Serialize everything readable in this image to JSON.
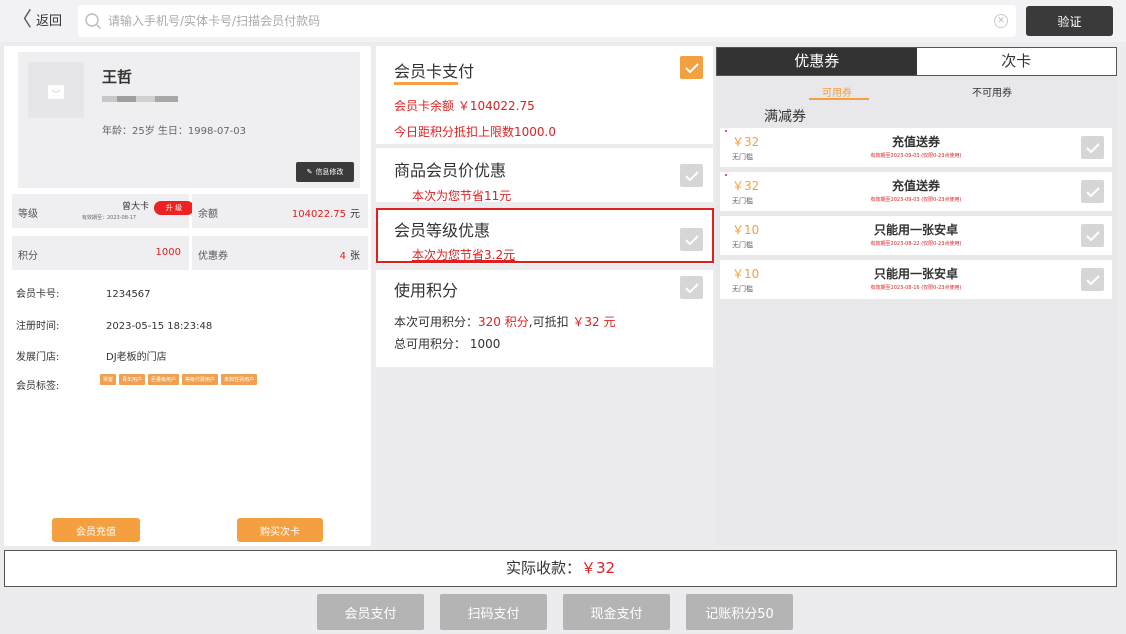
{
  "topbar": {
    "back_label": "返回",
    "search_placeholder": "请输入手机号/实体卡号/扫描会员付款码",
    "verify_label": "验证"
  },
  "member": {
    "name": "王哲",
    "age_birth": "年龄：25岁  生日：1998-07-03",
    "edit_label": "信息修改",
    "level_label": "等级",
    "level_name": "曾大卡",
    "level_expiry": "有效期至：2023-08-17",
    "upgrade_label": "升 级",
    "balance_label": "余额",
    "balance_value": "104022.75",
    "balance_unit": "元",
    "points_label": "积分",
    "points_value": "1000",
    "coupons_label": "优惠券",
    "coupons_value": "4",
    "coupons_unit": "张",
    "card_no_label": "会员卡号:",
    "card_no": "1234567",
    "reg_time_label": "注册时间:",
    "reg_time": "2023-05-15 18:23:48",
    "store_label": "发展门店:",
    "store": "DJ老板的门店",
    "tags_label": "会员标签:",
    "tags": [
      "常客",
      "青年用户",
      "巨量级用户",
      "等级付费用户",
      "未知性别用户"
    ],
    "recharge_label": "会员充值",
    "buy_card_label": "购买次卡"
  },
  "payment": {
    "card_pay_title": "会员卡支付",
    "card_balance": "会员卡余额  ￥104022.75",
    "points_limit": "今日距积分抵扣上限数1000.0",
    "price_discount_title": "商品会员价优惠",
    "price_discount_save": "本次为您节省11元",
    "level_discount_title": "会员等级优惠",
    "level_discount_save": "本次为您节省3.2元",
    "use_points_title": "使用积分",
    "points_usable_prefix": "本次可用积分：",
    "points_usable": "320 积分",
    "points_deduct_prefix": ",可抵扣",
    "points_deduct": "￥32 元",
    "points_total": "总可用积分：  1000",
    "card_pay_checked": true,
    "price_discount_checked": false,
    "level_discount_checked": false,
    "use_points_checked": false
  },
  "coupons": {
    "tab_coupons": "优惠券",
    "tab_cards": "次卡",
    "sub_available": "可用券",
    "sub_unavailable": "不可用券",
    "type_label": "满减券",
    "items": [
      {
        "amount": "￥32",
        "threshold": "无门槛",
        "name": "充值送券",
        "validity": "有效期至2023-09-03 (仅限0-23点使用)"
      },
      {
        "amount": "￥32",
        "threshold": "无门槛",
        "name": "充值送券",
        "validity": "有效期至2023-09-03 (仅限0-23点使用)"
      },
      {
        "amount": "￥10",
        "threshold": "无门槛",
        "name": "只能用一张安卓",
        "validity": "有效期至2023-08-22 (仅限0-23点使用)"
      },
      {
        "amount": "￥10",
        "threshold": "无门槛",
        "name": "只能用一张安卓",
        "validity": "有效期至2023-08-16 (仅限0-23点使用)"
      }
    ]
  },
  "footer": {
    "total_label": "实际收款：",
    "total_value": "￥32",
    "pay_buttons": [
      "会员支付",
      "扫码支付",
      "现金支付",
      "记账积分50"
    ]
  },
  "colors": {
    "accent": "#f5a040",
    "danger": "#e02020",
    "dark": "#3a3a3a"
  }
}
